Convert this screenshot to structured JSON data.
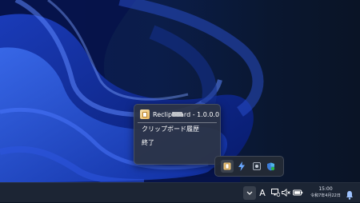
{
  "context_menu": {
    "app_title": "Reclipboard - 1.0.0.0",
    "items": [
      {
        "label": "クリップボード履歴"
      },
      {
        "label": "終了"
      }
    ]
  },
  "tray_flyout": {
    "icons": [
      "reclipboard-icon",
      "lightning-icon",
      "app-icon",
      "shield-icon"
    ]
  },
  "taskbar": {
    "ime_label": "A",
    "clock": {
      "time": "15:00",
      "date": "令和7年4月22日"
    }
  },
  "colors": {
    "accent": "#3a6ad8",
    "taskbar": "#1c2534",
    "menu": "#2c3444"
  }
}
